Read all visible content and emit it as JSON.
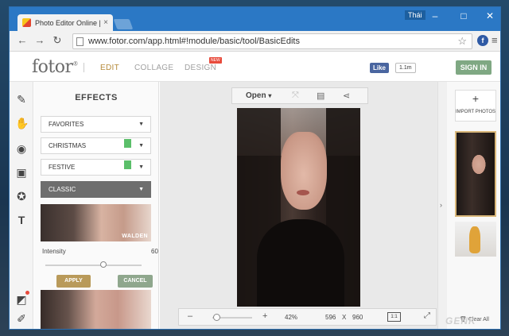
{
  "browser": {
    "tab_title": "Photo Editor Online | Fotor",
    "tab_close": "×",
    "user_label": "Thái",
    "url": "www.fotor.com/app.html#!module/basic/tool/BasicEdits",
    "window_controls": {
      "minimize": "–",
      "maximize": "□",
      "close": "✕"
    },
    "nav": {
      "back": "←",
      "forward": "→",
      "reload": "↻"
    },
    "star": "☆",
    "ext_icon": "f",
    "menu": "≡"
  },
  "header": {
    "logo": "fotor",
    "nav": {
      "edit": "EDIT",
      "collage": "COLLAGE",
      "design": "DESIGN"
    },
    "new_badge": "NEW",
    "fb_like": "Like",
    "fb_count": "1.1m",
    "signin": "SIGN IN",
    "colors": {
      "edit_active": "#b68a3a",
      "inactive": "#a0a0a0",
      "signin": "#7fa883"
    }
  },
  "tools": [
    {
      "name": "pencil-icon",
      "glyph": "✎"
    },
    {
      "name": "hand-icon",
      "glyph": "✋"
    },
    {
      "name": "eye-icon",
      "glyph": "◉"
    },
    {
      "name": "frame-icon",
      "glyph": "▣"
    },
    {
      "name": "sticker-icon",
      "glyph": "✪"
    },
    {
      "name": "text-icon",
      "glyph": "T"
    },
    {
      "name": "layers-icon",
      "glyph": "◩"
    },
    {
      "name": "edit-square-icon",
      "glyph": "✐"
    }
  ],
  "effects": {
    "title": "EFFECTS",
    "categories": [
      {
        "label": "FAVORITES",
        "flag": false
      },
      {
        "label": "CHRISTMAS",
        "flag": true
      },
      {
        "label": "FESTIVE",
        "flag": true
      },
      {
        "label": "CLASSIC",
        "flag": false,
        "active": true
      }
    ],
    "caret": "▼",
    "preview_label": "WALDEN",
    "intensity_label": "Intensity",
    "intensity_value": "60",
    "intensity_level": 0.6,
    "apply": "APPLY",
    "cancel": "CANCEL"
  },
  "canvas": {
    "open": "Open",
    "open_caret": "▾",
    "icons": {
      "crop": "⤧",
      "save": "▤",
      "share": "⋖"
    },
    "zoom_out": "–",
    "zoom_in": "+",
    "zoom": "42%",
    "width": "596",
    "x": "X",
    "height": "960",
    "ratio": "1:1",
    "fit": "⤢",
    "zoom_level": 0.1
  },
  "right_panel": {
    "collapse": "›",
    "import_plus": "+",
    "import_label": "IMPORT PHOTOS",
    "clear_all": "Clear All",
    "trash_icon": "🗑"
  },
  "watermark": "GENK"
}
